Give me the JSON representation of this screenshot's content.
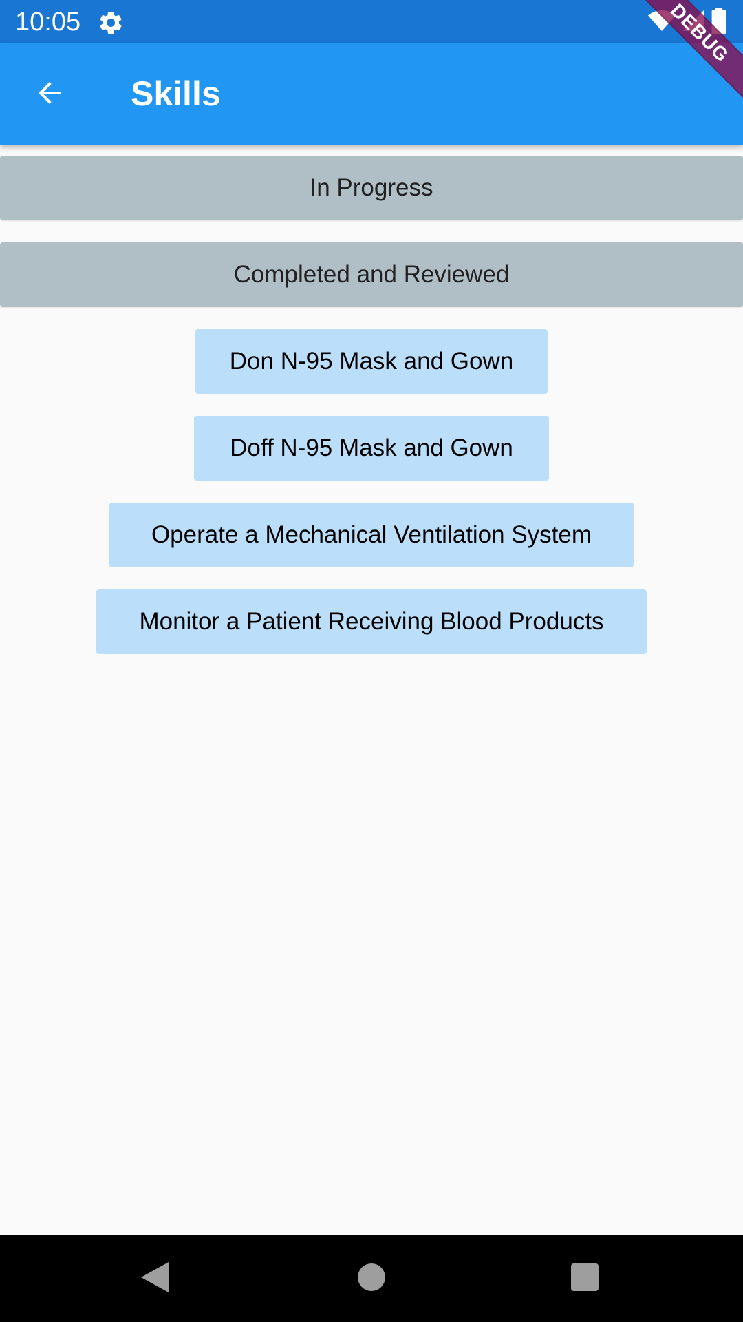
{
  "status_bar": {
    "time": "10:05",
    "icons": [
      "settings-gear-icon",
      "wifi-icon",
      "cell-signal-icon",
      "battery-icon"
    ]
  },
  "app_bar": {
    "title": "Skills",
    "back_icon": "arrow-back-icon",
    "color": "#2196f3"
  },
  "debug_banner": "DEBUG",
  "sections": [
    {
      "label": "In Progress"
    },
    {
      "label": "Completed and Reviewed"
    }
  ],
  "skills": [
    {
      "label": "Don N-95 Mask and Gown"
    },
    {
      "label": "Doff N-95 Mask and Gown"
    },
    {
      "label": "Operate a Mechanical Ventilation System"
    },
    {
      "label": "Monitor a Patient Receiving Blood Products"
    }
  ],
  "nav_bar": {
    "icons": [
      "back-triangle-icon",
      "home-circle-icon",
      "recents-square-icon"
    ]
  },
  "colors": {
    "status_bar": "#1976d2",
    "section_header": "#b0bec5",
    "skill_button": "#bbdefb",
    "background": "#fafafa"
  }
}
